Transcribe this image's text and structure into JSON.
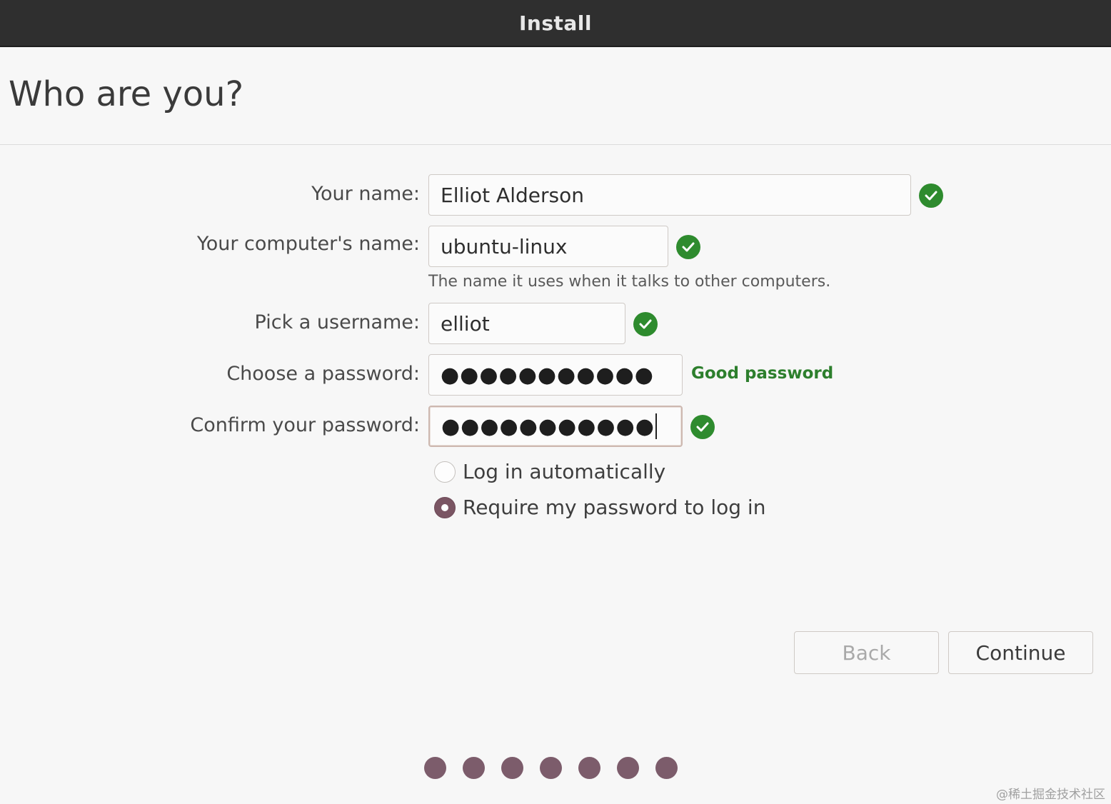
{
  "window": {
    "title": "Install"
  },
  "page": {
    "heading": "Who are you?"
  },
  "form": {
    "name": {
      "label": "Your name:",
      "value": "Elliot Alderson",
      "valid": true
    },
    "computer": {
      "label": "Your computer's name:",
      "value": "ubuntu-linux",
      "hint": "The name it uses when it talks to other computers.",
      "valid": true
    },
    "username": {
      "label": "Pick a username:",
      "value": "elliot",
      "valid": true
    },
    "password": {
      "label": "Choose a password:",
      "masked": "●●●●●●●●●●●",
      "strength": "Good password"
    },
    "confirm": {
      "label": "Confirm your password:",
      "masked": "●●●●●●●●●●●",
      "valid": true
    }
  },
  "login_options": [
    {
      "label": "Log in automatically",
      "selected": false
    },
    {
      "label": "Require my password to log in",
      "selected": true
    }
  ],
  "buttons": {
    "back": "Back",
    "continue": "Continue",
    "back_enabled": false
  },
  "progress": {
    "total_steps": 7
  },
  "watermark": "@稀土掘金技术社区",
  "colors": {
    "titlebar": "#2f2f2f",
    "valid_check": "#2e8b2e",
    "good_password": "#2d7f2d",
    "accent": "#7a5563"
  },
  "icons": {
    "valid": "check-circle-icon"
  }
}
